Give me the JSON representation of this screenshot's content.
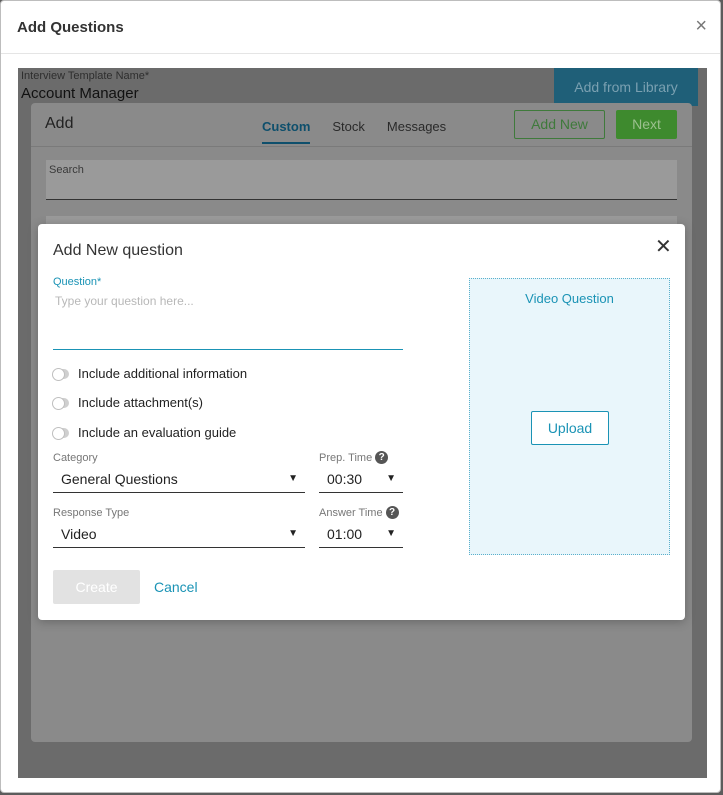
{
  "outer": {
    "title": "Add Questions",
    "close_glyph": "×"
  },
  "background": {
    "template_name_label": "Interview Template Name*",
    "template_name_value": "Account Manager",
    "add_from_library_label": "Add from Library"
  },
  "add_panel": {
    "title": "Add",
    "tabs": [
      {
        "label": "Custom",
        "active": true
      },
      {
        "label": "Stock",
        "active": false
      },
      {
        "label": "Messages",
        "active": false
      }
    ],
    "add_new_label": "Add New",
    "next_label": "Next",
    "search_label": "Search"
  },
  "dialog": {
    "title": "Add New question",
    "close_glyph": "✕",
    "question_label": "Question*",
    "question_placeholder": "Type your question here...",
    "question_value": "",
    "toggles": [
      {
        "label": "Include additional information",
        "on": false
      },
      {
        "label": "Include attachment(s)",
        "on": false
      },
      {
        "label": "Include an evaluation guide",
        "on": false
      }
    ],
    "category_label": "Category",
    "category_value": "General Questions",
    "prep_time_label": "Prep. Time",
    "prep_time_value": "00:30",
    "response_type_label": "Response Type",
    "response_type_value": "Video",
    "answer_time_label": "Answer Time",
    "answer_time_value": "01:00",
    "help_glyph": "?",
    "caret_glyph": "▼",
    "create_label": "Create",
    "cancel_label": "Cancel",
    "video_title": "Video Question",
    "upload_label": "Upload"
  },
  "colors": {
    "accent": "#1a93b5",
    "green": "#3e8a2e",
    "disabled_button": "#e2e2e2"
  }
}
